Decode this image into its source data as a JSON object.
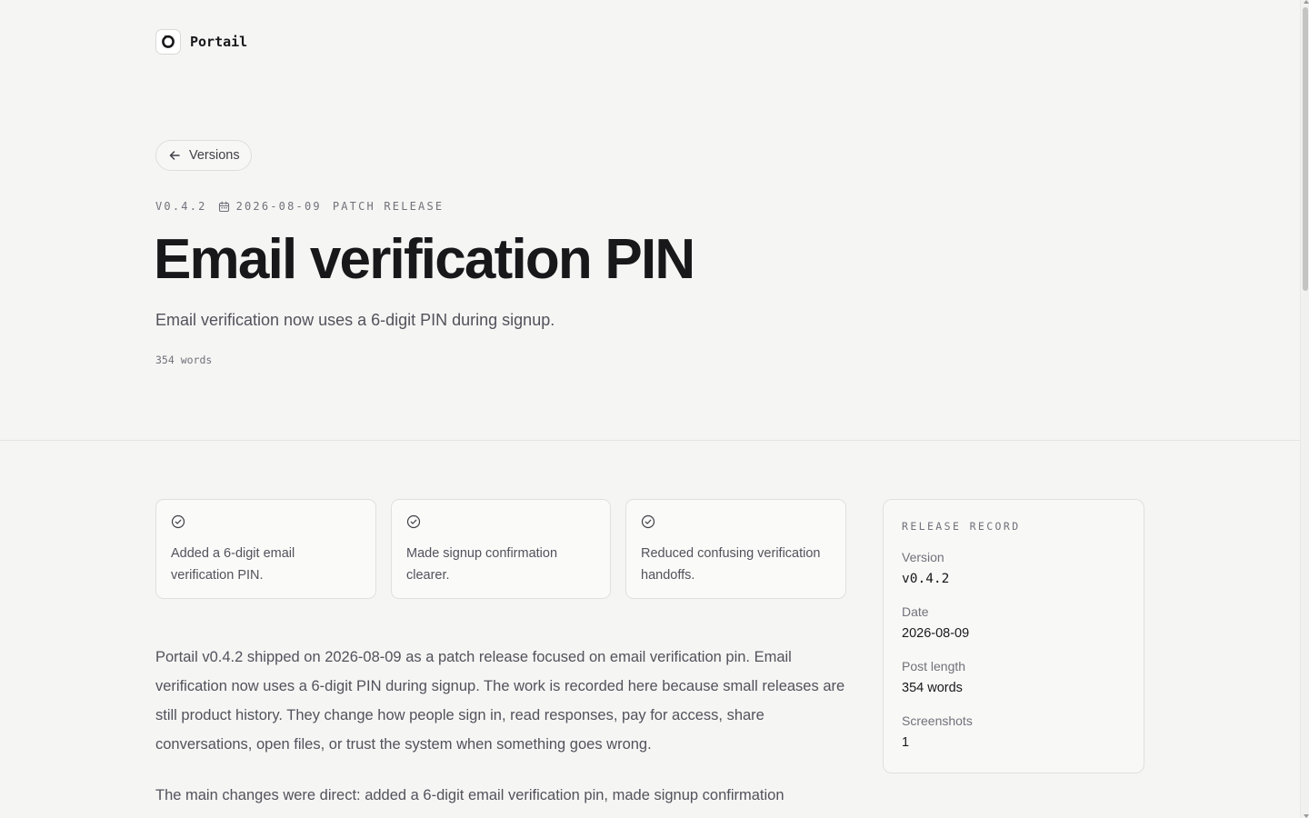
{
  "header": {
    "brand": "Portail"
  },
  "back_button": {
    "label": "Versions"
  },
  "meta": {
    "version": "V0.4.2",
    "date": "2026-08-09",
    "type": "PATCH RELEASE"
  },
  "title": "Email verification PIN",
  "subtitle": "Email verification now uses a 6-digit PIN during signup.",
  "word_count": "354 words",
  "highlights": [
    {
      "icon": "check-circle-icon",
      "text": "Added a 6-digit email verification PIN."
    },
    {
      "icon": "check-circle-icon",
      "text": "Made signup confirmation clearer."
    },
    {
      "icon": "check-circle-icon",
      "text": "Reduced confusing verification handoffs."
    }
  ],
  "body": [
    "Portail v0.4.2 shipped on 2026-08-09 as a patch release focused on email verification pin. Email verification now uses a 6-digit PIN during signup. The work is recorded here because small releases are still product history. They change how people sign in, read responses, pay for access, share conversations, open files, or trust the system when something goes wrong.",
    "The main changes were direct: added a 6-digit email verification pin, made signup confirmation"
  ],
  "record": {
    "heading": "RELEASE RECORD",
    "items": [
      {
        "label": "Version",
        "value": "v0.4.2"
      },
      {
        "label": "Date",
        "value": "2026-08-09"
      },
      {
        "label": "Post length",
        "value": "354 words"
      },
      {
        "label": "Screenshots",
        "value": "1"
      }
    ]
  }
}
